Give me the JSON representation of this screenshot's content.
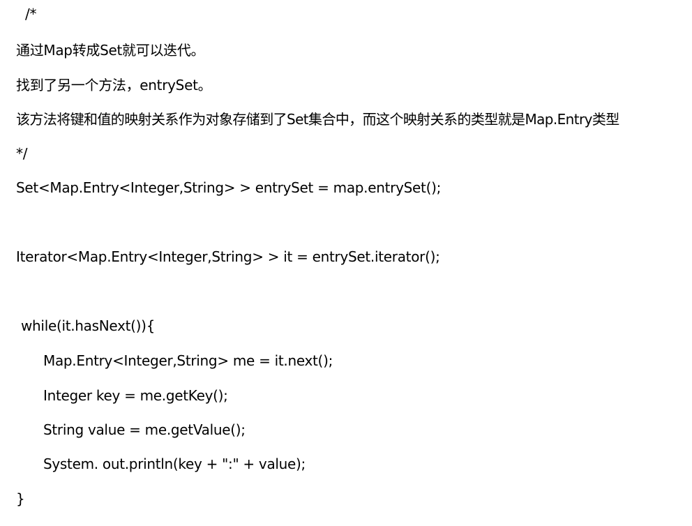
{
  "document": {
    "lines": [
      " /*",
      "通过Map转成Set就可以迭代。",
      "找到了另一个方法，entrySet。",
      "该方法将键和值的映射关系作为对象存储到了Set集合中，而这个映射关系的类型就是Map.Entry类型",
      "*/",
      "Set<Map.Entry<Integer,String> > entrySet = map.entrySet();",
      "Iterator<Map.Entry<Integer,String> > it = entrySet.iterator();",
      "while(it.hasNext()){",
      "Map.Entry<Integer,String> me = it.next();",
      "Integer key = me.getKey();",
      "String value = me.getValue();",
      "System. out.println(key + \":\" + value);",
      "}"
    ]
  }
}
